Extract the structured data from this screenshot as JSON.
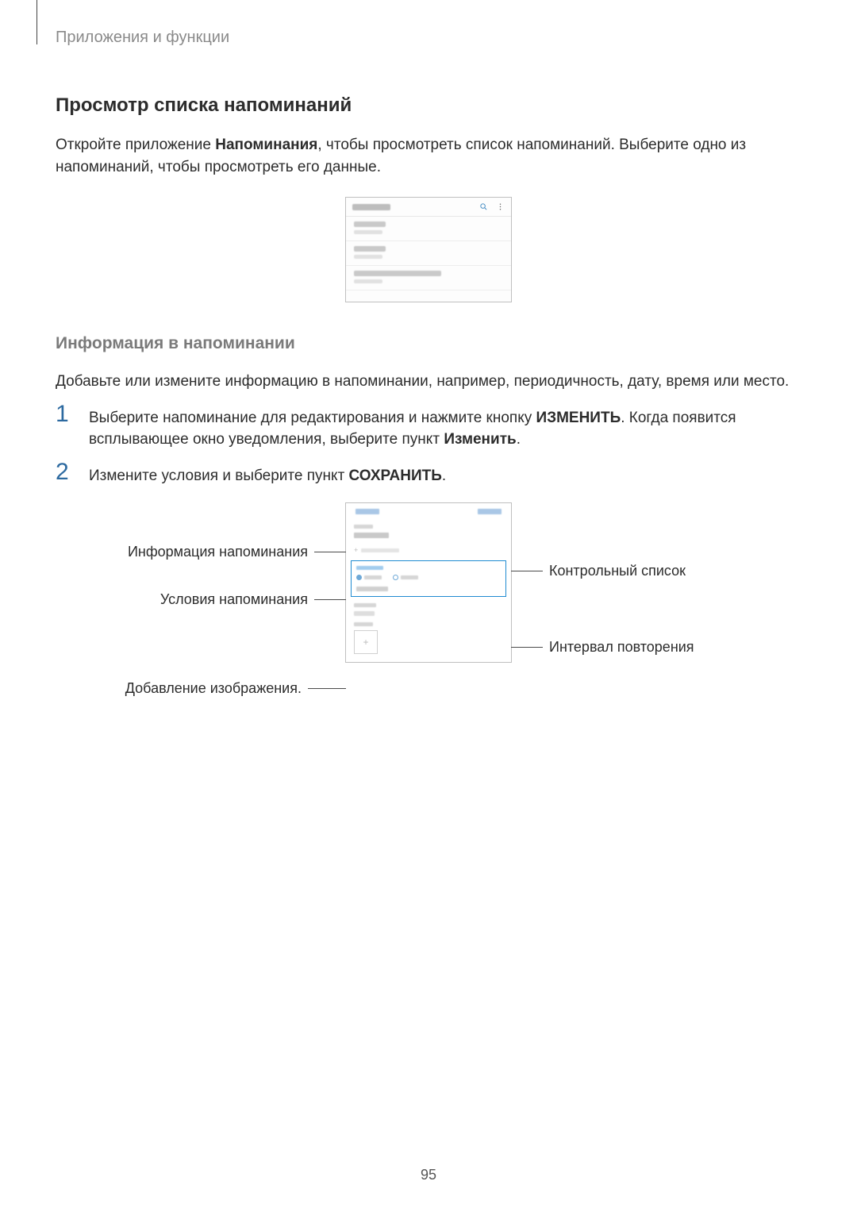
{
  "breadcrumb": "Приложения и функции",
  "section_heading": "Просмотр списка напоминаний",
  "intro_part1": "Откройте приложение ",
  "intro_app_name": "Напоминания",
  "intro_part2": ", чтобы просмотреть список напоминаний. Выберите одно из напоминаний, чтобы просмотреть его данные.",
  "subsection_heading": "Информация в напоминании",
  "subsection_body": "Добавьте или измените информацию в напоминании, например, периодичность, дату, время или место.",
  "step1_num": "1",
  "step1_part1": "Выберите напоминание для редактирования и нажмите кнопку ",
  "step1_bold1": "ИЗМЕНИТЬ",
  "step1_part2": ". Когда появится всплывающее окно уведомления, выберите пункт ",
  "step1_bold2": "Изменить",
  "step1_part3": ".",
  "step2_num": "2",
  "step2_part1": "Измените условия и выберите пункт ",
  "step2_bold1": "СОХРАНИТЬ",
  "step2_part2": ".",
  "callouts": {
    "info": "Информация напоминания",
    "conditions": "Условия напоминания",
    "add_image": "Добавление изображения.",
    "checklist": "Контрольный список",
    "repeat": "Интервал повторения"
  },
  "plus_glyph": "+",
  "page_number": "95"
}
